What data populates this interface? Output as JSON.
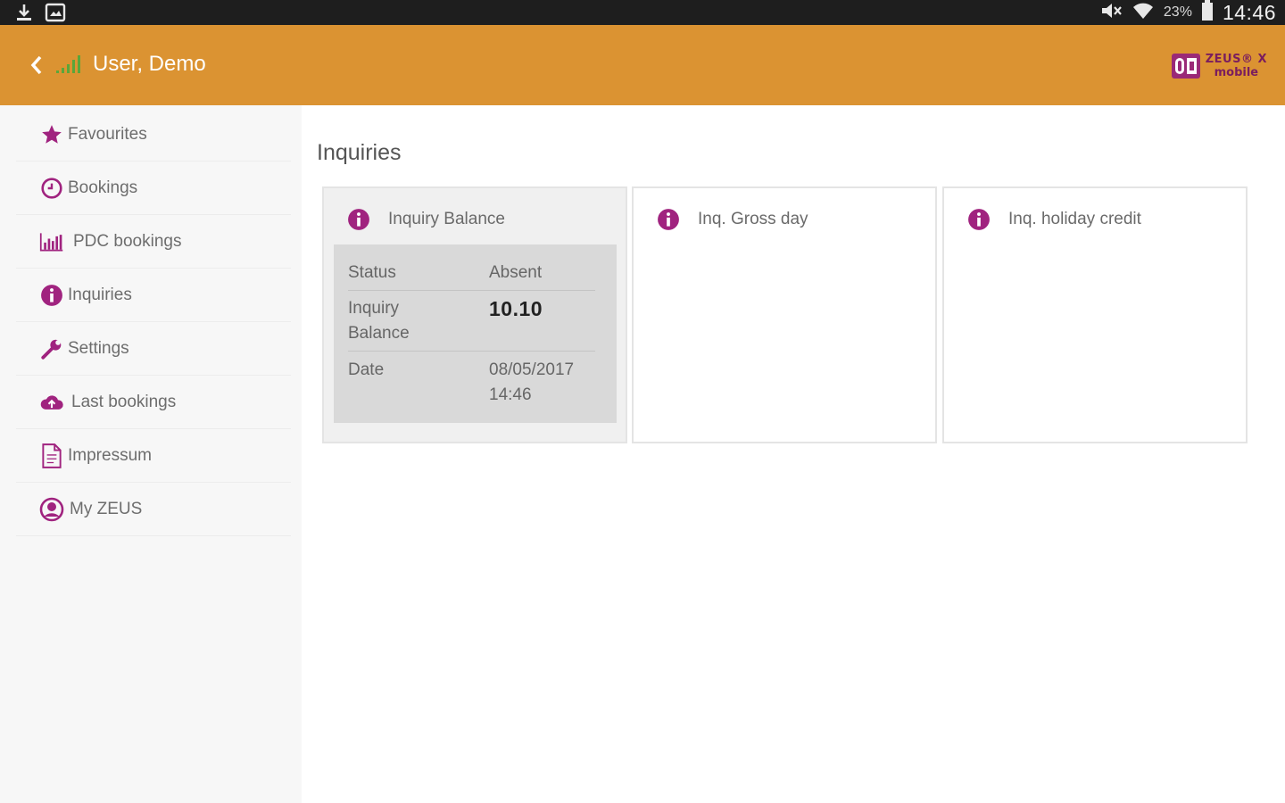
{
  "status_bar": {
    "left_icons": [
      "download-icon",
      "screenshot-icon"
    ],
    "right_icons": [
      "mute-icon",
      "wifi-icon"
    ],
    "battery": "23%",
    "time": "14:46"
  },
  "header": {
    "user_name": "User, Demo",
    "logo_line1": "ZEUS® X",
    "logo_line2": "mobile",
    "colors": {
      "header_bg": "#db9332",
      "accent": "#a0237f"
    }
  },
  "sidebar": {
    "items": [
      {
        "label": "Favourites",
        "icon": "star-icon"
      },
      {
        "label": "Bookings",
        "icon": "clock-icon"
      },
      {
        "label": "PDC bookings",
        "icon": "bar-chart-icon"
      },
      {
        "label": "Inquiries",
        "icon": "info-icon"
      },
      {
        "label": "Settings",
        "icon": "wrench-icon"
      },
      {
        "label": "Last bookings",
        "icon": "cloud-upload-icon"
      },
      {
        "label": "Impressum",
        "icon": "document-icon"
      },
      {
        "label": "My ZEUS",
        "icon": "user-icon"
      }
    ]
  },
  "main": {
    "title": "Inquiries",
    "cards": [
      {
        "title": "Inquiry Balance",
        "details": {
          "status_key": "Status",
          "status_value": "Absent",
          "balance_key": "Inquiry Balance",
          "balance_value": "10.10",
          "date_key": "Date",
          "date_value": "08/05/2017 14:46"
        }
      },
      {
        "title": "Inq. Gross day"
      },
      {
        "title": "Inq. holiday credit"
      }
    ]
  }
}
